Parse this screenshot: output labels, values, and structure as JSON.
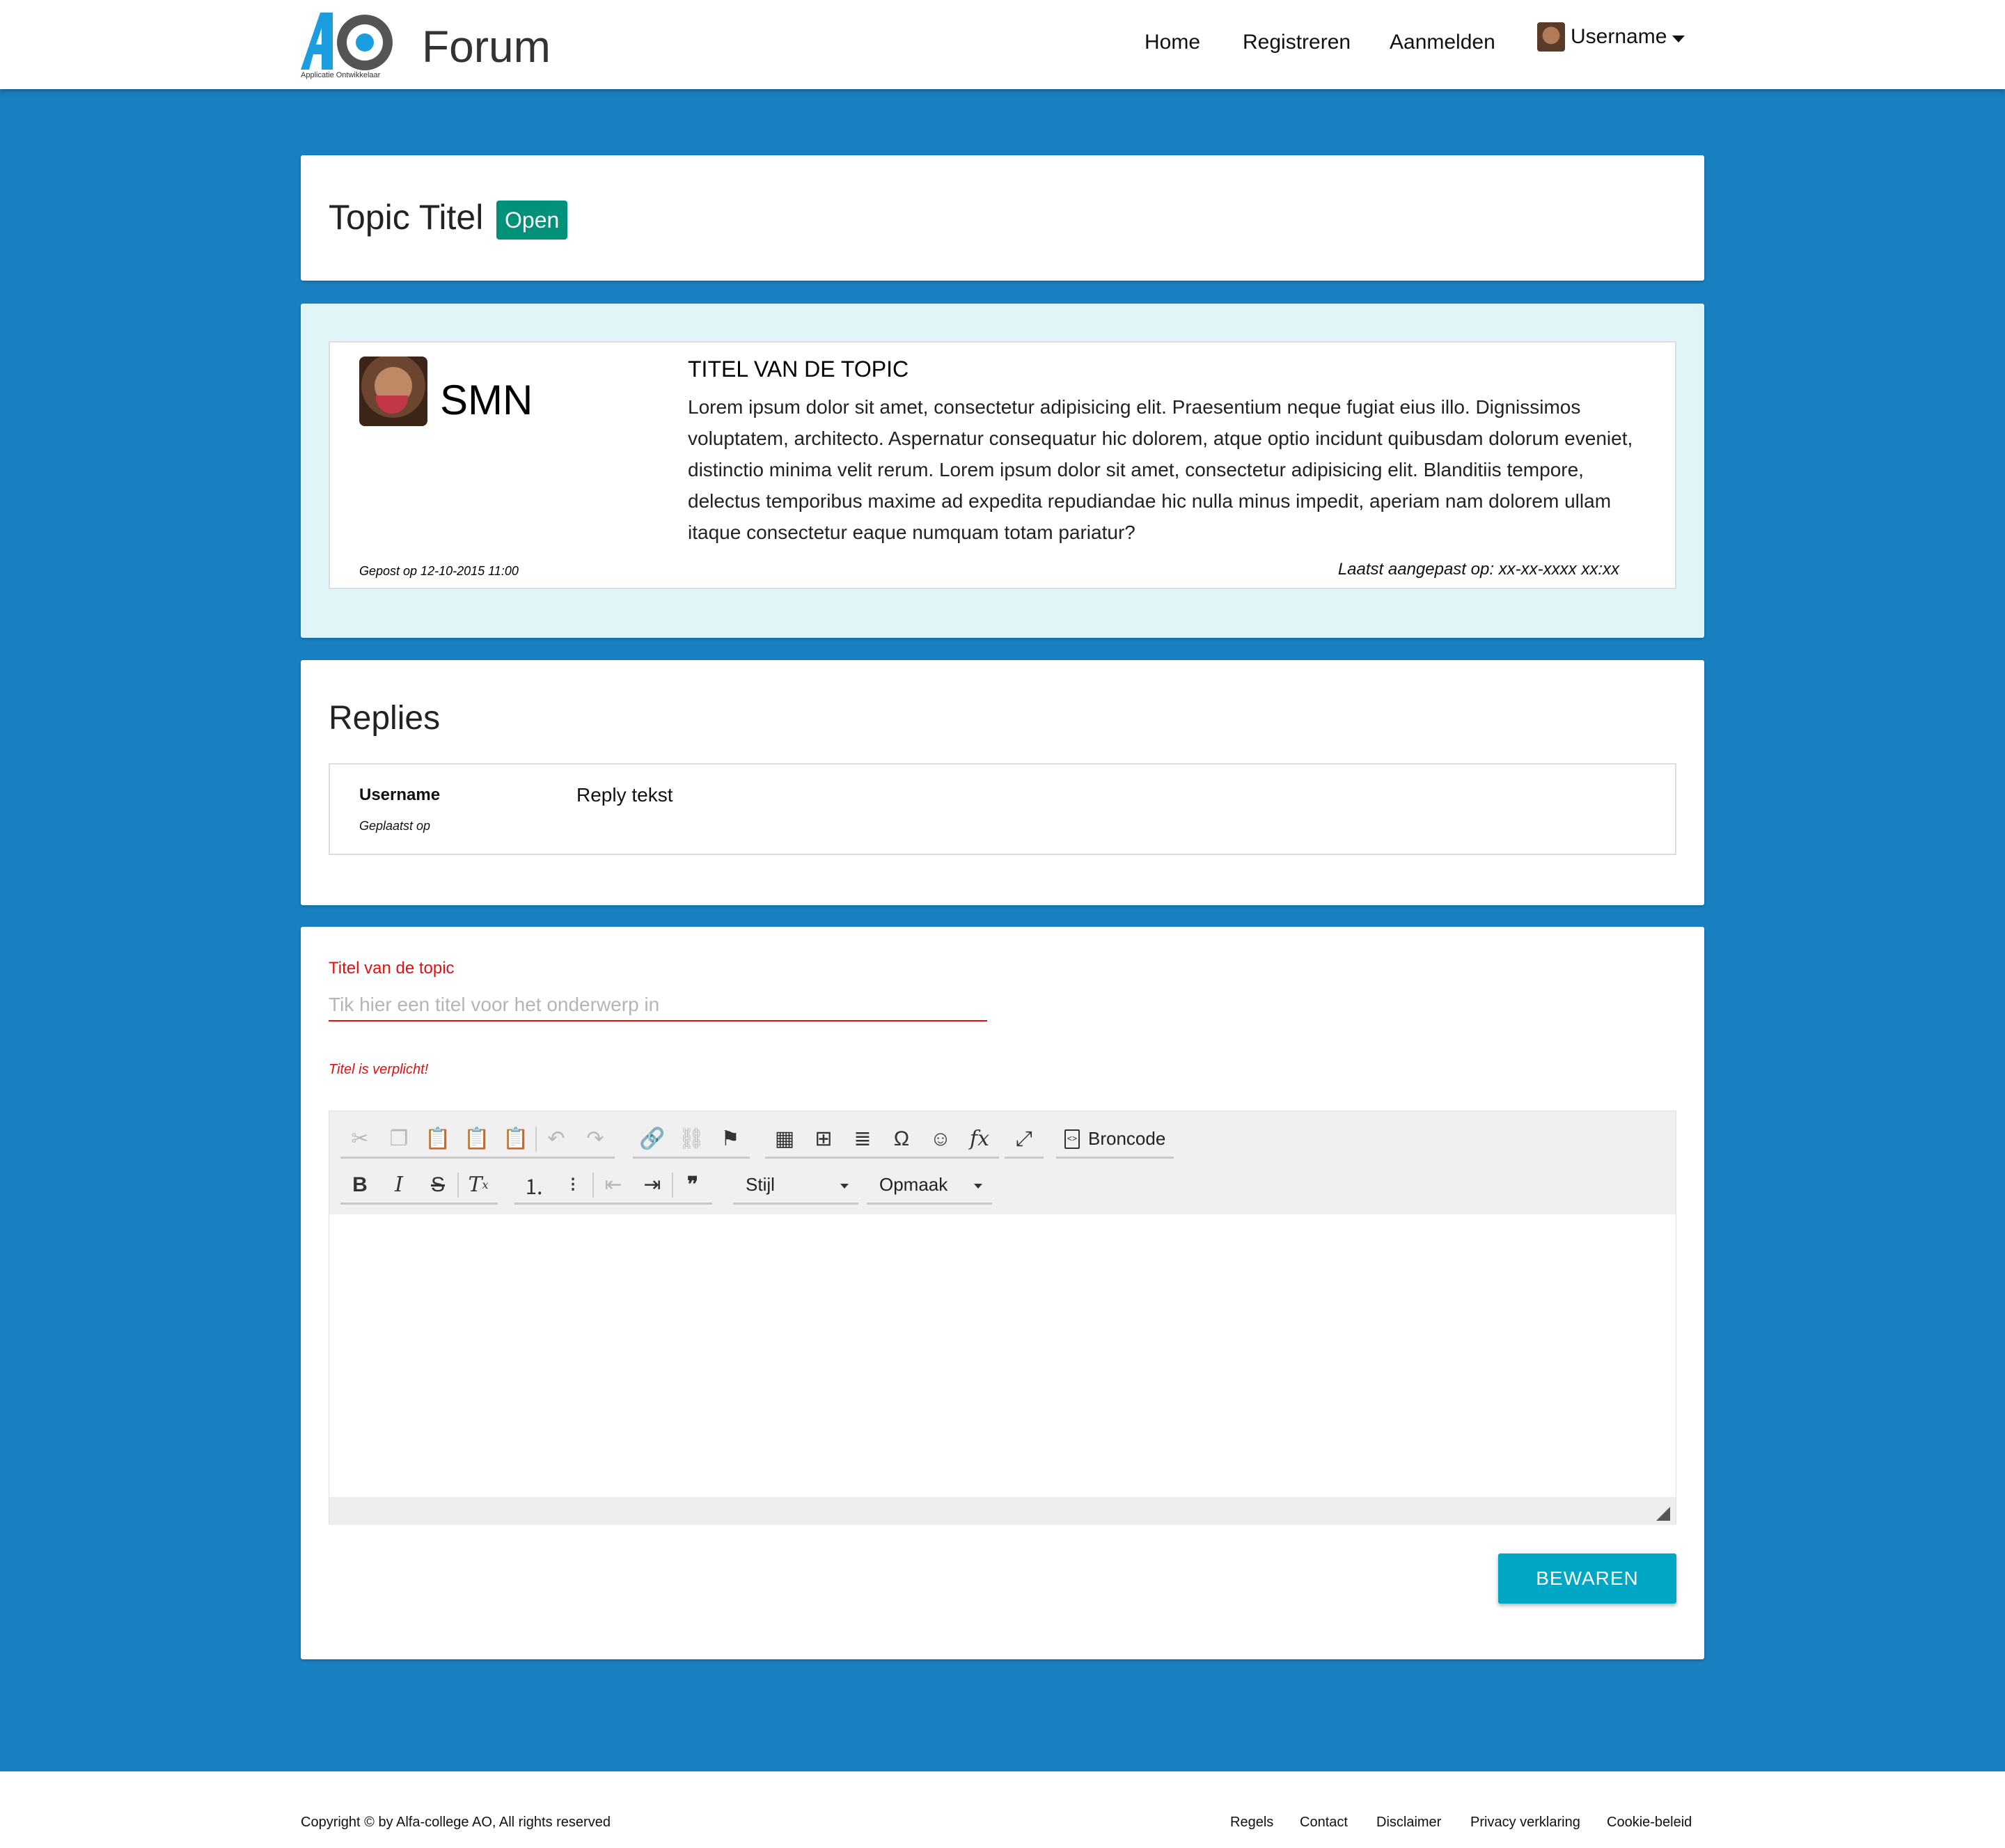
{
  "header": {
    "logo_text": "AO",
    "logo_subtitle": "Applicatie Ontwikkelaar",
    "brand": "Forum",
    "nav": {
      "home": "Home",
      "register": "Registreren",
      "login": "Aanmelden",
      "user": "Username"
    }
  },
  "topic": {
    "title": "Topic Titel",
    "status": "Open"
  },
  "post": {
    "author": "SMN",
    "heading": "TITEL VAN DE TOPIC",
    "body": "Lorem ipsum dolor sit amet, consectetur adipisicing elit. Praesentium neque fugiat eius illo. Dignissimos voluptatem, architecto. Aspernatur consequatur hic dolorem, atque optio incidunt quibusdam dolorum eveniet, distinctio minima velit rerum. Lorem ipsum dolor sit amet, consectetur adipisicing elit. Blanditiis tempore, delectus temporibus maxime ad expedita repudiandae hic nulla minus impedit, aperiam nam dolorem ullam itaque consectetur eaque numquam totam pariatur?",
    "posted": "Gepost op 12-10-2015 11:00",
    "edited": "Laatst aangepast op: xx-xx-xxxx xx:xx"
  },
  "replies": {
    "title": "Replies",
    "items": [
      {
        "user": "Username",
        "date": "Geplaatst op",
        "text": "Reply tekst"
      }
    ]
  },
  "form": {
    "title_label": "Titel van de topic",
    "title_placeholder": "Tik hier een titel voor het onderwerp in",
    "title_value": "",
    "error": "Titel is verplicht!",
    "editor": {
      "source_label": "Broncode",
      "style_label": "Stijl",
      "format_label": "Opmaak",
      "icons": {
        "row1": [
          "cut-icon",
          "copy-icon",
          "paste-icon",
          "paste-text-icon",
          "paste-word-icon",
          "undo-icon",
          "redo-icon",
          "link-icon",
          "unlink-icon",
          "anchor-icon",
          "image-icon",
          "table-icon",
          "horizontal-line-icon",
          "special-char-icon",
          "smiley-icon",
          "formula-icon",
          "maximize-icon",
          "source-icon"
        ],
        "row2": [
          "bold-icon",
          "italic-icon",
          "strike-icon",
          "remove-format-icon",
          "numbered-list-icon",
          "bulleted-list-icon",
          "outdent-icon",
          "indent-icon",
          "blockquote-icon"
        ]
      }
    },
    "save_label": "BEWAREN"
  },
  "footer": {
    "copyright": "Copyright © by Alfa-college AO, All rights reserved",
    "links": [
      "Regels",
      "Contact",
      "Disclaimer",
      "Privacy verklaring",
      "Cookie-beleid"
    ]
  },
  "colors": {
    "background": "#1980c1",
    "badge": "#00917a",
    "post_bg": "#dff5f8",
    "error": "#e01010",
    "save_button": "#00a7c4",
    "logo_blue": "#1a9ee0",
    "logo_gray": "#555555"
  }
}
